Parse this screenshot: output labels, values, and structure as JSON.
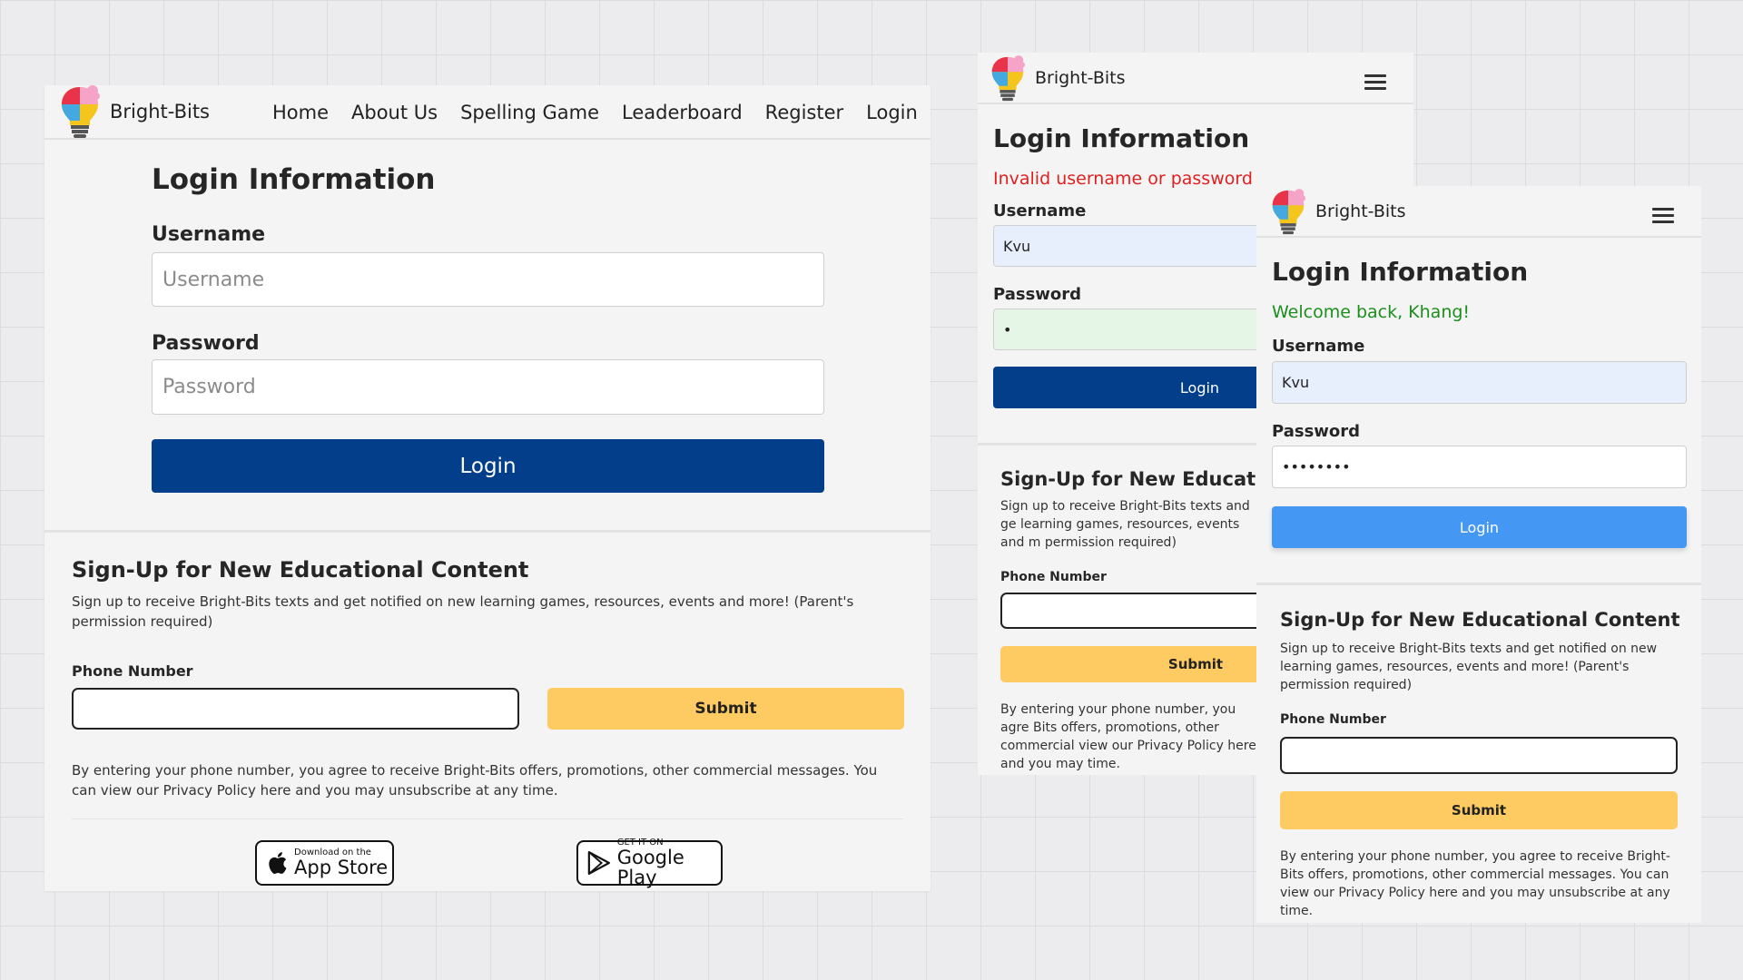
{
  "brand": {
    "name": "Bright-Bits"
  },
  "desktop": {
    "nav": {
      "links": [
        "Home",
        "About Us",
        "Spelling Game",
        "Leaderboard",
        "Register",
        "Login"
      ]
    },
    "login": {
      "title": "Login Information",
      "username_label": "Username",
      "username_placeholder": "Username",
      "password_label": "Password",
      "password_placeholder": "Password",
      "button": "Login"
    },
    "signup": {
      "title": "Sign-Up for New Educational Content",
      "description": "Sign up to receive Bright-Bits texts and get notified on new learning games, resources, events and more! (Parent's permission required)",
      "phone_label": "Phone Number",
      "submit": "Submit",
      "disclaimer": "By entering your phone number, you agree to receive Bright-Bits offers, promotions, other commercial messages. You can view our Privacy Policy here and you may unsubscribe at any time."
    },
    "badges": {
      "appstore_small": "Download on the",
      "appstore_big": "App Store",
      "googleplay_small": "GET IT ON",
      "googleplay_big": "Google Play"
    }
  },
  "mobile_error": {
    "login": {
      "title": "Login Information",
      "message": "Invalid username or password",
      "username_label": "Username",
      "username_value": "Kvu",
      "password_label": "Password",
      "password_value": "•",
      "button": "Login"
    },
    "signup": {
      "title": "Sign-Up for New Education",
      "description": "Sign up to receive Bright-Bits texts and ge learning games, resources, events and m permission required)",
      "phone_label": "Phone Number",
      "submit": "Submit",
      "disclaimer": "By entering your phone number, you agre Bits offers, promotions, other commercial view our Privacy Policy here and you may time."
    }
  },
  "mobile_success": {
    "login": {
      "title": "Login Information",
      "message": "Welcome back, Khang!",
      "username_label": "Username",
      "username_value": "Kvu",
      "password_label": "Password",
      "password_value": "••••••••",
      "button": "Login"
    },
    "signup": {
      "title": "Sign-Up for New Educational Content",
      "description": "Sign up to receive Bright-Bits texts and get notified on new learning games, resources, events and more! (Parent's permission required)",
      "phone_label": "Phone Number",
      "submit": "Submit",
      "disclaimer": "By entering your phone number, you agree to receive Bright-Bits offers, promotions, other commercial messages. You can view our Privacy Policy here and you may unsubscribe at any time."
    }
  },
  "colors": {
    "primary_blue": "#023e8a",
    "active_blue": "#4497f2",
    "submit_yellow": "#fecb63",
    "error_red": "#e01f1f",
    "success_green": "#1b8f1b"
  },
  "icons": {
    "logo": "lightbulb-puzzle-logo-icon",
    "menu": "hamburger-menu-icon",
    "apple": "apple-icon",
    "play": "google-play-icon"
  }
}
